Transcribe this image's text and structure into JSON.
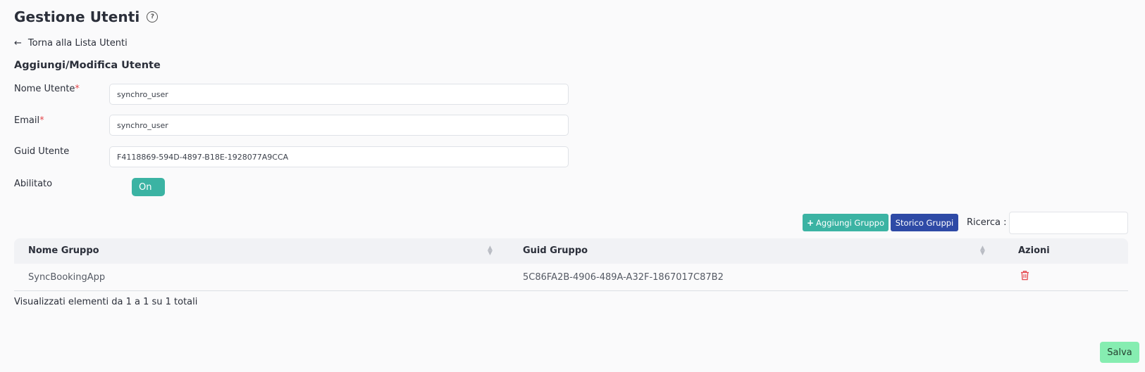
{
  "header": {
    "title": "Gestione Utenti",
    "help_icon": "?"
  },
  "back_link": {
    "label": "Torna alla Lista Utenti",
    "arrow": "←"
  },
  "form": {
    "section_title": "Aggiungi/Modifica Utente",
    "required_mark": "*",
    "username": {
      "label": "Nome Utente",
      "value": "synchro_user"
    },
    "email": {
      "label": "Email",
      "value": "synchro_user"
    },
    "guid": {
      "label": "Guid Utente",
      "value": "F4118869-594D-4897-B18E-1928077A9CCA"
    },
    "enabled": {
      "label": "Abilitato",
      "toggle_label": "On"
    }
  },
  "groups_toolbar": {
    "add_label": "Aggiungi Gruppo",
    "add_icon": "+",
    "history_label": "Storico Gruppi",
    "search_label": "Ricerca :"
  },
  "groups_table": {
    "columns": [
      "Nome Gruppo",
      "Guid Gruppo",
      "Azioni"
    ],
    "rows": [
      {
        "name": "SyncBookingApp",
        "guid": "5C86FA2B-4906-489A-A32F-1867017C87B2"
      }
    ],
    "info": "Visualizzati elementi da 1 a 1 su 1 totali"
  },
  "save_label": "Salva",
  "colors": {
    "accent": "#3bb3a3",
    "history": "#2e4aa6",
    "save": "#86edb1",
    "danger": "#e5484d"
  }
}
